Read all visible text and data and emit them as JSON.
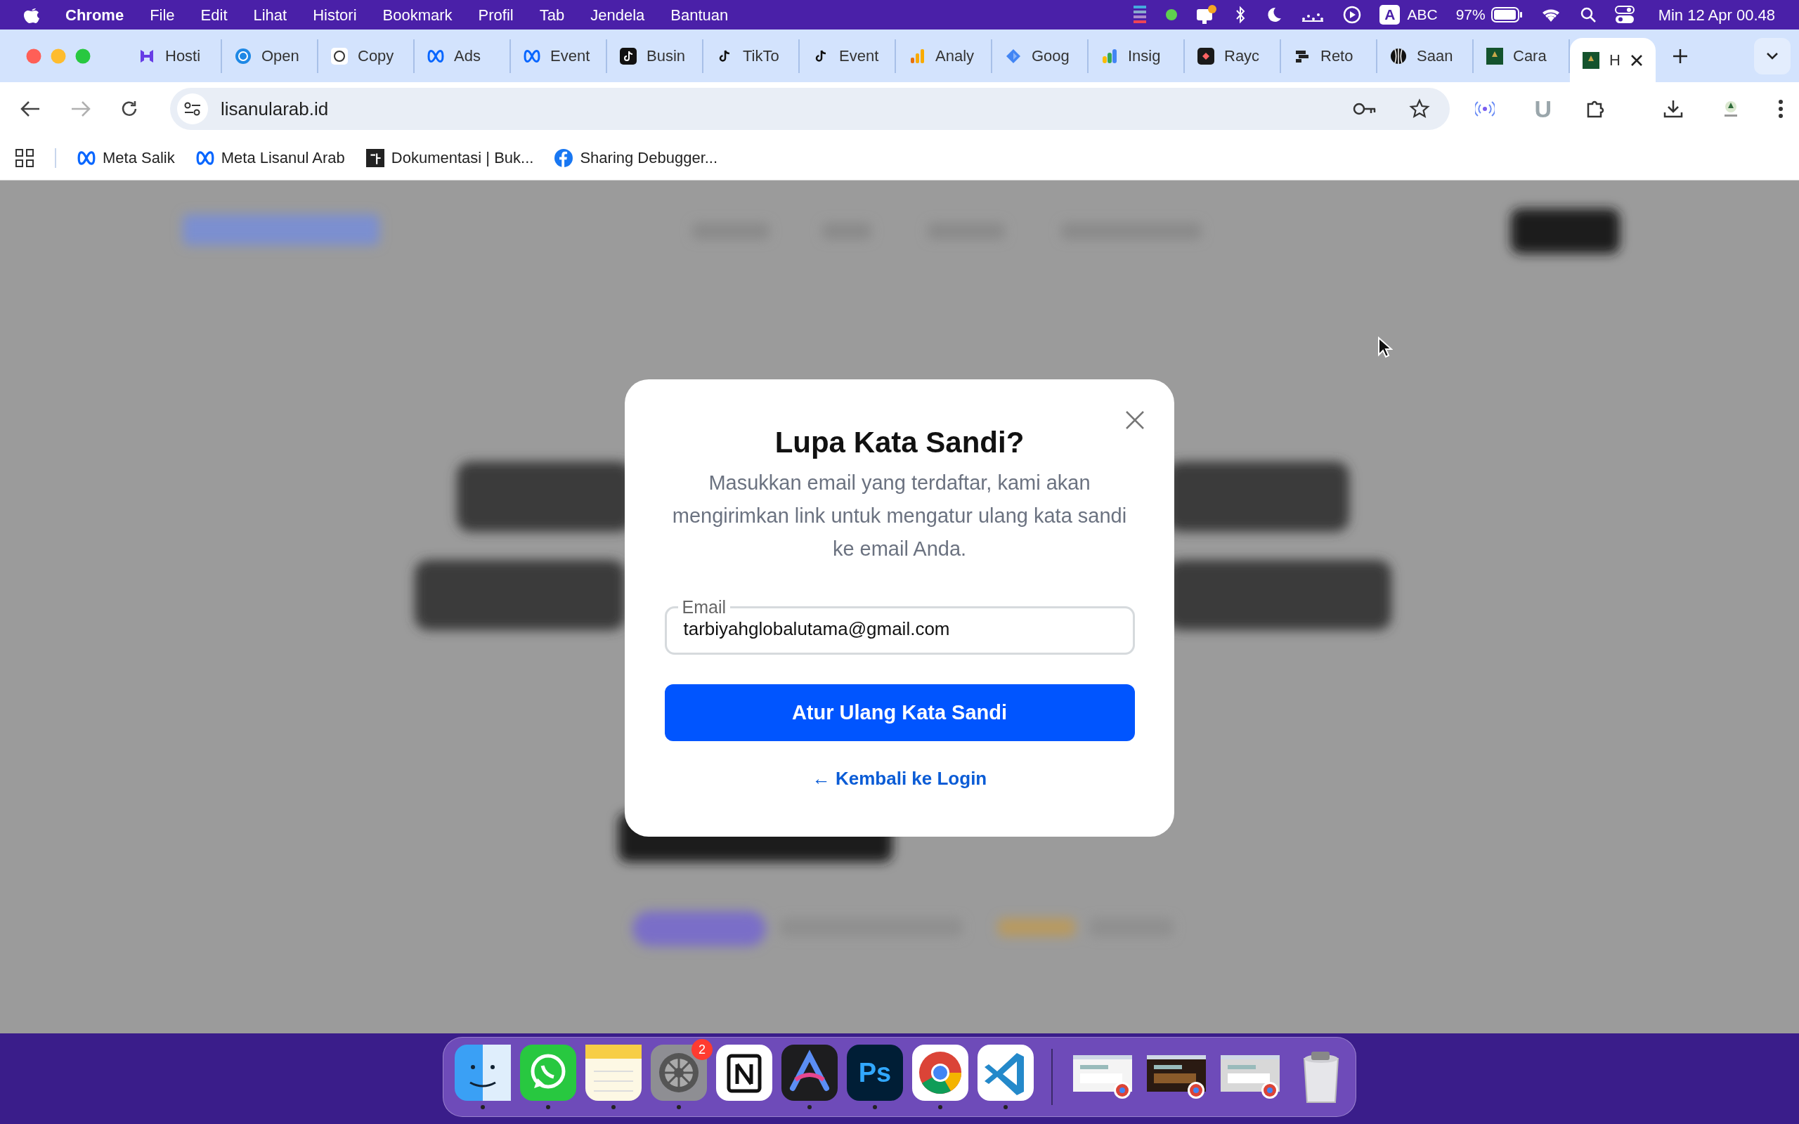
{
  "menu_bar": {
    "app": "Chrome",
    "items": [
      "File",
      "Edit",
      "Lihat",
      "Histori",
      "Bookmark",
      "Profil",
      "Tab",
      "Jendela",
      "Bantuan"
    ],
    "input_source": "A",
    "input_label": "ABC",
    "battery": "97%",
    "clock": "Min 12 Apr  00.48"
  },
  "tabs": [
    {
      "label": "Hosti",
      "selected": false
    },
    {
      "label": "Open",
      "selected": false
    },
    {
      "label": "Copy",
      "selected": false
    },
    {
      "label": "Ads",
      "selected": false
    },
    {
      "label": "Event",
      "selected": false
    },
    {
      "label": "Busin",
      "selected": false
    },
    {
      "label": "TikTo",
      "selected": false
    },
    {
      "label": "Event",
      "selected": false
    },
    {
      "label": "Analy",
      "selected": false
    },
    {
      "label": "Goog",
      "selected": false
    },
    {
      "label": "Insig",
      "selected": false
    },
    {
      "label": "Rayc",
      "selected": false
    },
    {
      "label": "Reto",
      "selected": false
    },
    {
      "label": "Saan",
      "selected": false
    },
    {
      "label": "Cara",
      "selected": false
    },
    {
      "label": "H",
      "selected": true
    }
  ],
  "toolbar": {
    "url": "lisanularab.id",
    "forward_disabled": true,
    "extension_letter": "U"
  },
  "bookmarks": [
    "Meta Salik",
    "Meta Lisanul Arab",
    "Dokumentasi | Buk...",
    "Sharing Debugger..."
  ],
  "dialog": {
    "title": "Lupa Kata Sandi?",
    "description": "Masukkan email yang terdaftar, kami akan mengirimkan link untuk mengatur ulang kata sandi ke email Anda.",
    "field": {
      "label": "Email",
      "value": "tarbiyahglobalutama@gmail.com"
    },
    "submit": "Atur Ulang Kata Sandi",
    "back_link": "← Kembali ke Login"
  },
  "dock": {
    "apps": [
      {
        "kind": "finder",
        "running": true
      },
      {
        "kind": "whatsapp",
        "running": true
      },
      {
        "kind": "notes",
        "running": true
      },
      {
        "kind": "settings",
        "running": true,
        "badge": "2"
      },
      {
        "kind": "notion",
        "running": false
      },
      {
        "kind": "arc",
        "running": true
      },
      {
        "kind": "photoshop",
        "running": true,
        "label": "Ps"
      },
      {
        "kind": "chrome",
        "running": true
      },
      {
        "kind": "vscode",
        "running": true
      }
    ]
  }
}
